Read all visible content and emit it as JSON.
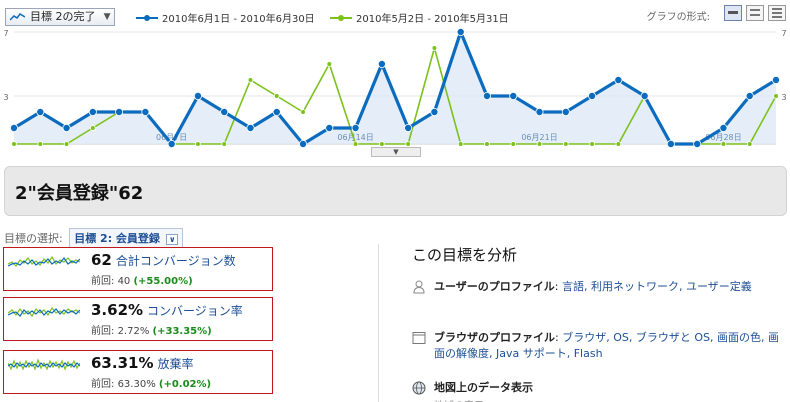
{
  "header": {
    "metric_select": "目標 2の完了",
    "legend": [
      {
        "label": "2010年6月1日 - 2010年6月30日",
        "color": "#0a6bbf"
      },
      {
        "label": "2010年5月2日 - 2010年5月31日",
        "color": "#7cc21a"
      }
    ],
    "graph_type_label": "グラフの形式:"
  },
  "chart_data": {
    "type": "line",
    "ylim": [
      0,
      7
    ],
    "y_ticks": [
      "7",
      "3"
    ],
    "x_tick_labels": [
      "06月7日",
      "06月14日",
      "06月21日",
      "06月28日"
    ],
    "x_tick_indices": [
      6,
      13,
      20,
      27
    ],
    "series": [
      {
        "name": "2010年6月1日 - 2010年6月30日",
        "color": "#0a6bbf",
        "values": [
          1,
          2,
          1,
          2,
          2,
          2,
          0,
          3,
          2,
          1,
          2,
          0,
          1,
          1,
          5,
          1,
          2,
          7,
          3,
          3,
          2,
          2,
          3,
          4,
          3,
          0,
          0,
          1,
          3,
          4
        ]
      },
      {
        "name": "2010年5月2日 - 2010年5月31日",
        "color": "#7cc21a",
        "values": [
          0,
          0,
          0,
          1,
          2,
          2,
          0,
          0,
          0,
          4,
          3,
          2,
          5,
          0,
          0,
          0,
          6,
          0,
          0,
          0,
          0,
          0,
          0,
          0,
          3,
          0,
          0,
          0,
          0,
          3
        ]
      }
    ]
  },
  "summary": {
    "title": "2\"会員登録\"62"
  },
  "goal_selector": {
    "label": "目標の選択:",
    "value": "目標 2: 会員登録"
  },
  "metrics": [
    {
      "value": "62",
      "name": "合計コンバージョン数",
      "prev_label": "前回:",
      "prev": "40",
      "delta": "(+55.00%)"
    },
    {
      "value": "3.62%",
      "name": "コンバージョン率",
      "prev_label": "前回:",
      "prev": "2.72%",
      "delta": "(+33.35%)"
    },
    {
      "value": "63.31%",
      "name": "放棄率",
      "prev_label": "前回:",
      "prev": "63.30%",
      "delta": "(+0.02%)"
    }
  ],
  "analyze": {
    "title": "この目標を分析",
    "items": [
      {
        "icon": "user-profile-icon",
        "label": "ユーザーのプロファイル",
        "links": "言語, 利用ネットワーク, ユーザー定義"
      },
      {
        "icon": "browser-window-icon",
        "label": "ブラウザのプロファイル",
        "links": "ブラウザ, OS, ブラウザと OS, 画面の色, 画面の解像度, Java サポート, Flash"
      },
      {
        "icon": "globe-icon",
        "label": "地図上のデータ表示",
        "links": ""
      }
    ],
    "stub": "地域の表示"
  }
}
